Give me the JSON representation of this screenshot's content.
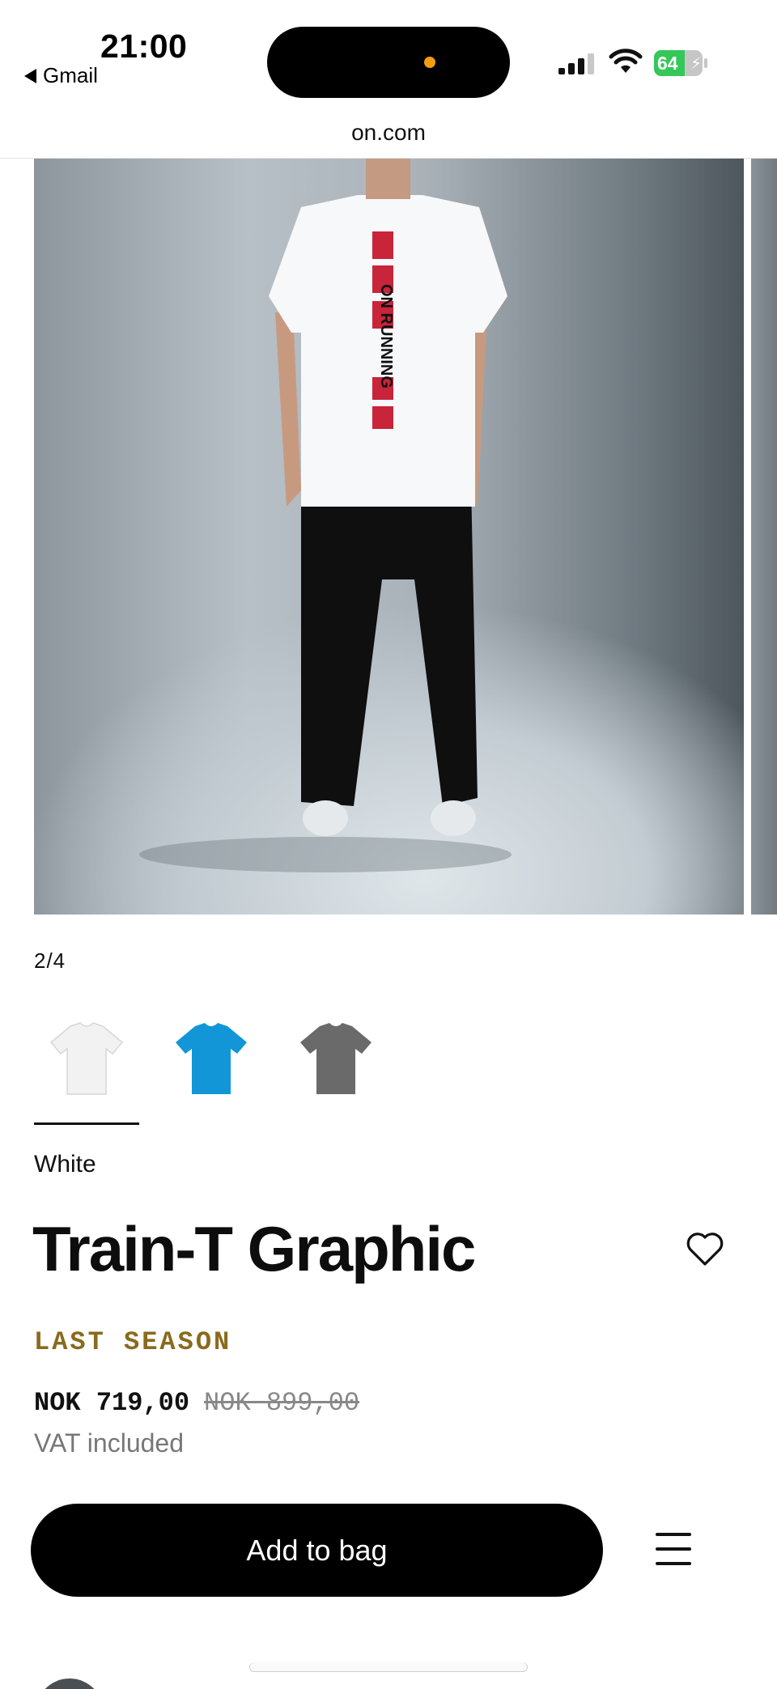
{
  "status_bar": {
    "time": "21:00",
    "back_app": "Gmail",
    "battery": "64",
    "battery_level": 0.64
  },
  "browser": {
    "url": "on.com"
  },
  "gallery": {
    "counter": "2/4",
    "current": 2,
    "total": 4
  },
  "swatches": [
    {
      "name": "White",
      "color": "#f2f2f2",
      "active": true
    },
    {
      "name": "Blue",
      "color": "#1296d8",
      "active": false
    },
    {
      "name": "Grey",
      "color": "#6a6a6a",
      "active": false
    }
  ],
  "product": {
    "color_name": "White",
    "title": "Train-T Graphic",
    "badge": "LAST SEASON",
    "price_now": "NOK 719,00",
    "price_old": "NOK 899,00",
    "vat": "VAT included",
    "print_text": "ON RUNNING"
  },
  "actions": {
    "add_to_bag": "Add to bag"
  },
  "icons": {
    "back": "back-triangle-icon",
    "signal": "cellular-signal-icon",
    "wifi": "wifi-icon",
    "battery": "battery-icon",
    "wishlist": "heart-icon",
    "menu": "hamburger-menu-icon"
  },
  "colors": {
    "badge": "#8a6a1c",
    "cta_bg": "#000000",
    "battery_green": "#34c759"
  }
}
